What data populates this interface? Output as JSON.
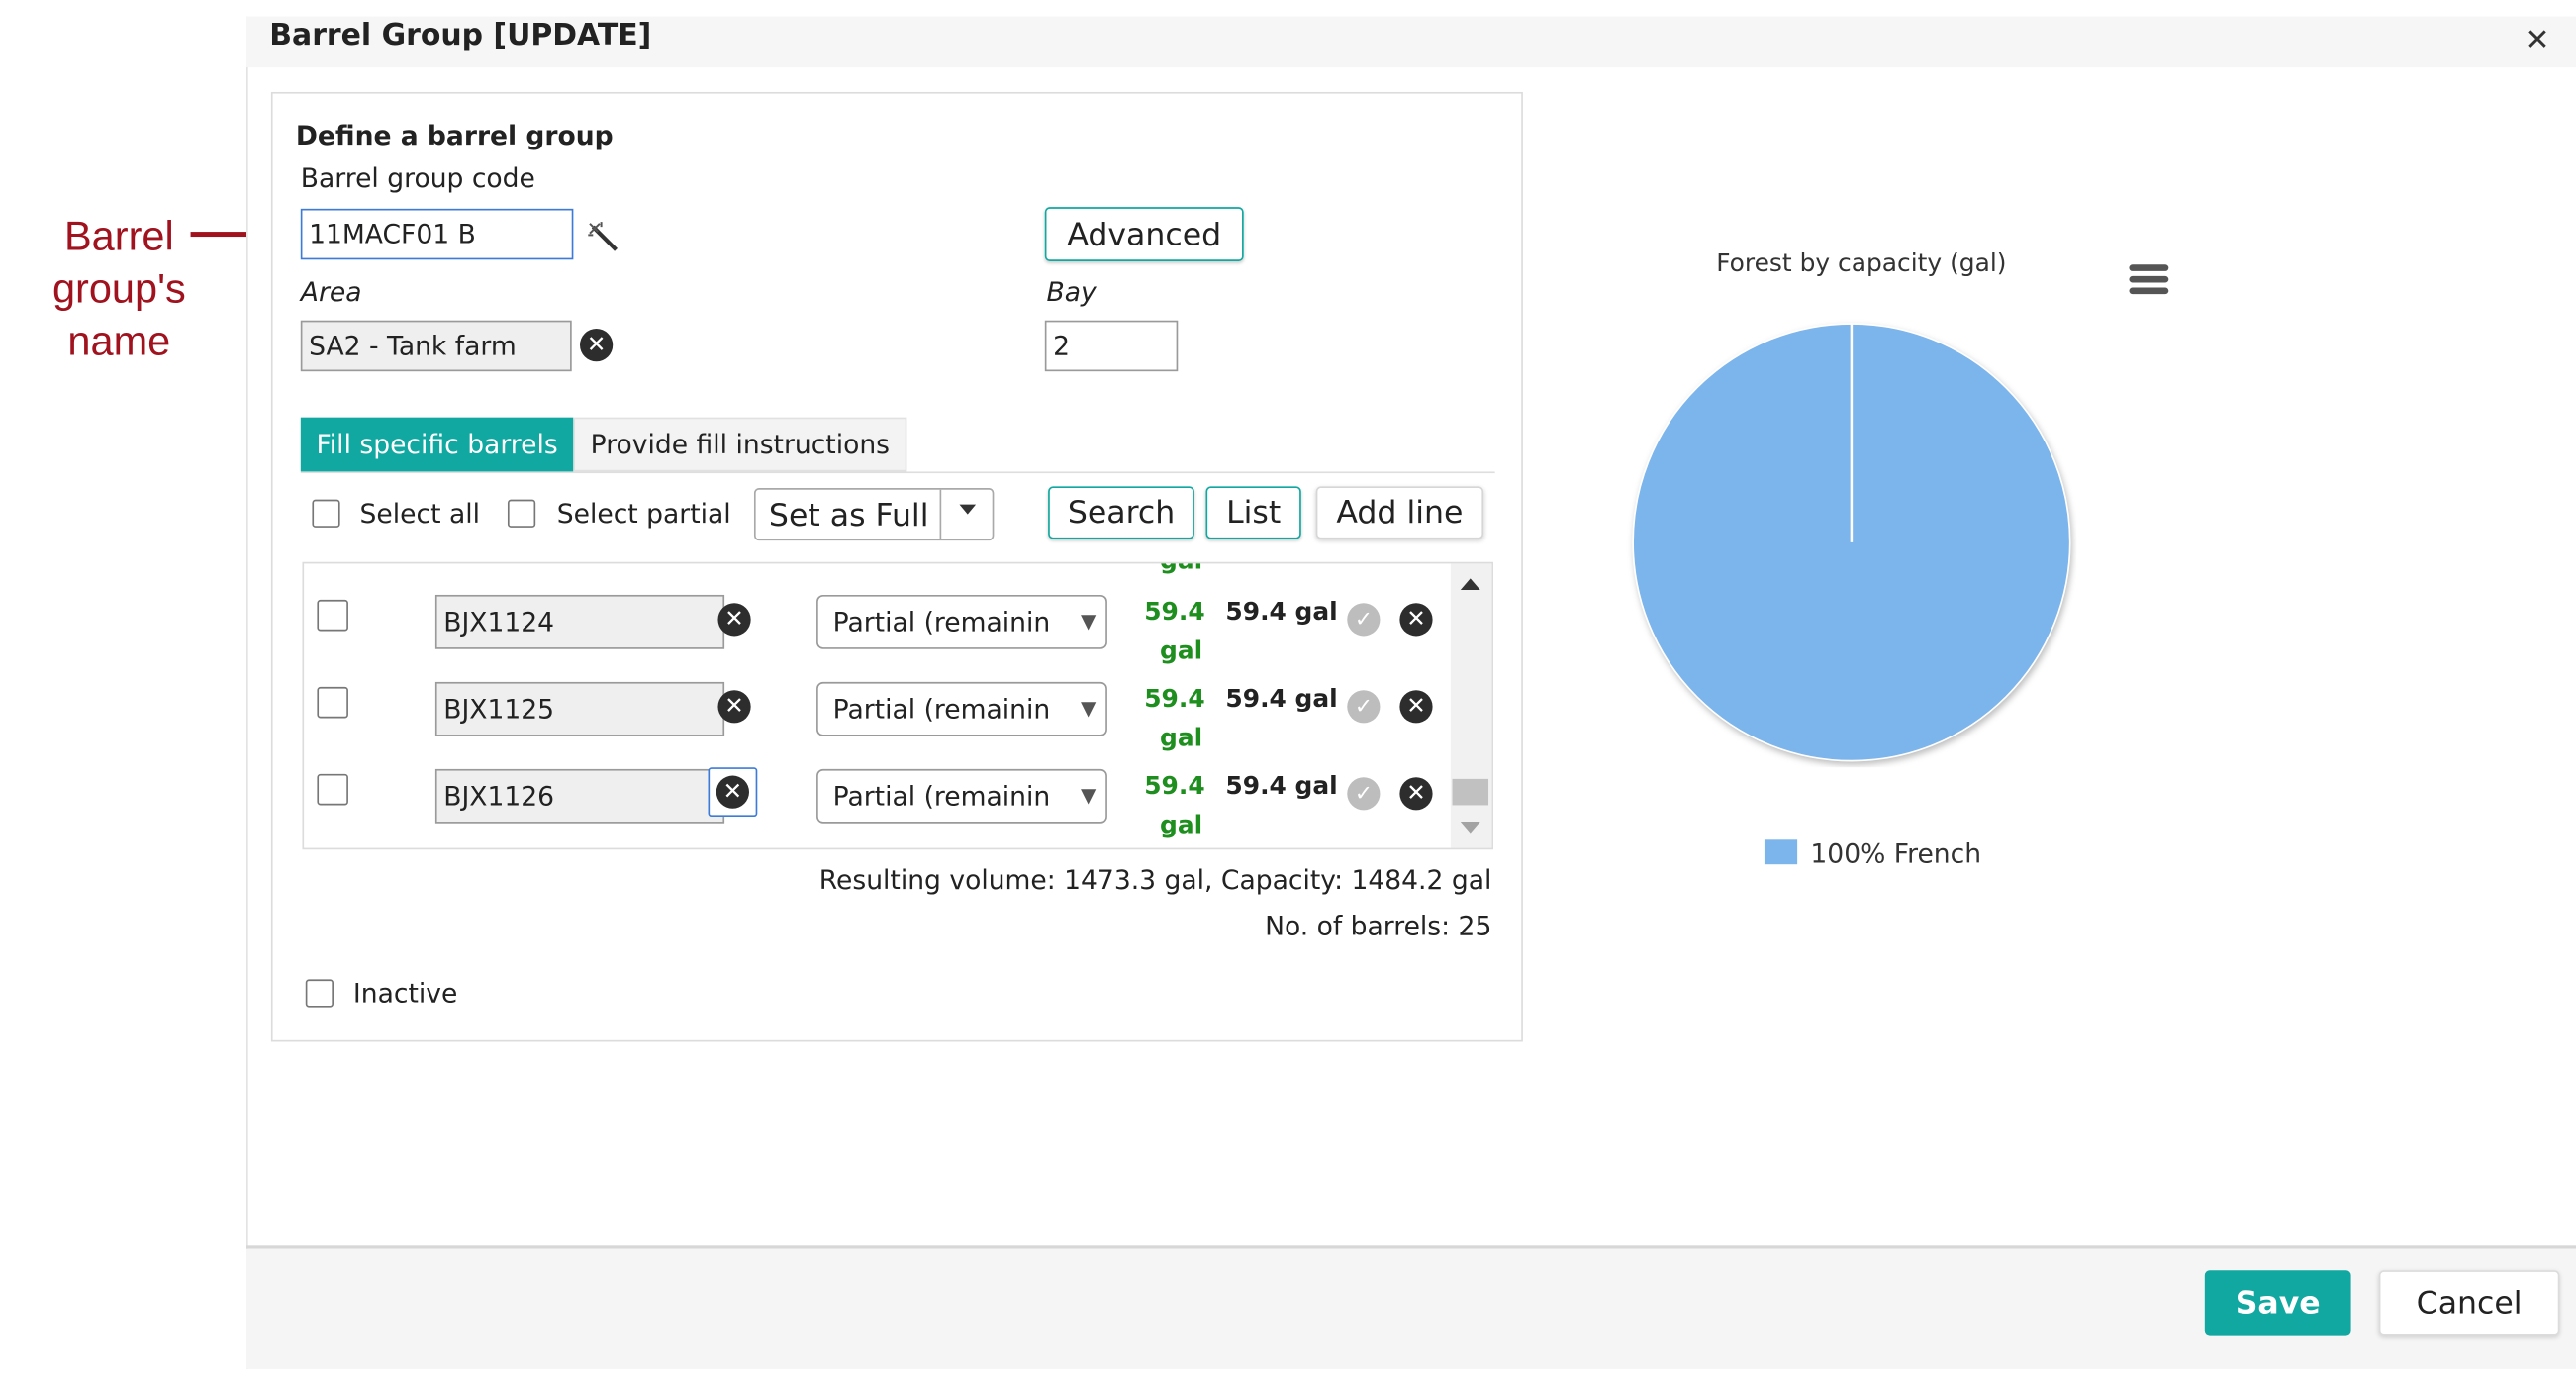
{
  "annotation": {
    "line1": "Barrel",
    "line2": "group's",
    "line3": "name"
  },
  "dialog": {
    "title": "Barrel Group [UPDATE]",
    "close_glyph": "✕"
  },
  "form": {
    "section_title": "Define a barrel group",
    "code_label": "Barrel group code",
    "code_value": "11MACF01 B",
    "advanced_label": "Advanced",
    "area_label": "Area",
    "area_value": "SA2 - Tank farm",
    "bay_label": "Bay",
    "bay_value": "2",
    "inactive_label": "Inactive"
  },
  "tabs": [
    {
      "label": "Fill specific barrels",
      "active": true
    },
    {
      "label": "Provide fill instructions",
      "active": false
    }
  ],
  "toolbar": {
    "select_all": "Select all",
    "select_partial": "Select partial",
    "set_as": "Set as Full",
    "search": "Search",
    "list": "List",
    "add_line": "Add line"
  },
  "table": {
    "clipped_text": "gal",
    "rows": [
      {
        "barrel": "BJX1124",
        "fill": "Partial (remainin",
        "green_value": "59.4",
        "green_unit": "gal",
        "volume": "59.4 gal"
      },
      {
        "barrel": "BJX1125",
        "fill": "Partial (remainin",
        "green_value": "59.4",
        "green_unit": "gal",
        "volume": "59.4 gal"
      },
      {
        "barrel": "BJX1126",
        "fill": "Partial (remainin",
        "green_value": "59.4",
        "green_unit": "gal",
        "volume": "59.4 gal"
      }
    ]
  },
  "summary": {
    "resulting": "Resulting volume: 1473.3 gal, Capacity: 1484.2 gal",
    "count": "No. of barrels: 25"
  },
  "chart_data": {
    "type": "pie",
    "title": "Forest by capacity (gal)",
    "slices": [
      {
        "label": "100% French",
        "value": 100,
        "color": "#7cb5ec"
      }
    ],
    "legend_position": "bottom"
  },
  "footer": {
    "save": "Save",
    "cancel": "Cancel"
  },
  "colors": {
    "accent": "#10a8a0",
    "annotation": "#a0121e",
    "pie": "#7cb5ec",
    "green": "#1e8e1e"
  }
}
